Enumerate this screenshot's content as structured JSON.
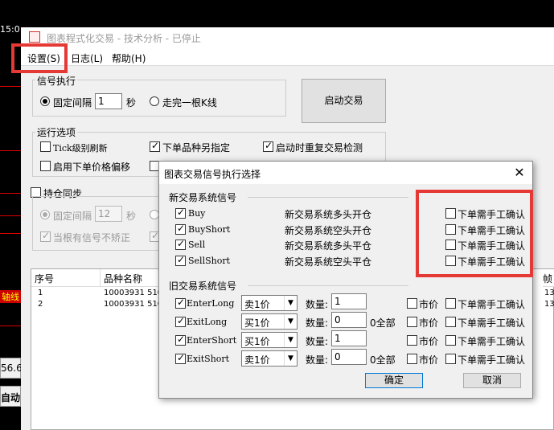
{
  "background": {
    "time_label": "15:0",
    "axis_label": "轴线",
    "price_label": "56.6",
    "auto_label": "自动"
  },
  "window": {
    "title": "图表程式化交易 - 技术分析 - 已停止",
    "menu": {
      "settings": "设置(S)",
      "log": "日志(L)",
      "help": "帮助(H)"
    }
  },
  "signal_exec": {
    "title": "信号执行",
    "fixed_interval_label": "固定间隔",
    "fixed_interval_value": "1",
    "seconds_unit": "秒",
    "finish_bar_label": "走完一根K线",
    "start_button": "启动交易"
  },
  "run_options": {
    "title": "运行选项",
    "tick_refresh": "Tick级别刷新",
    "specify_product": "下单品种另指定",
    "repeat_check": "启动时重复交易检测",
    "price_offset": "启用下单价格偏移"
  },
  "position_sync": {
    "title": "持仓同步",
    "fixed_interval_label": "固定间隔",
    "fixed_interval_value": "12",
    "seconds_unit": "秒",
    "no_correct": "当根有信号不矫正"
  },
  "table": {
    "headers": [
      "序号",
      "品种名称",
      "帧"
    ],
    "rows": [
      {
        "index": "1",
        "product": "10003931  510",
        "right": "13"
      },
      {
        "index": "2",
        "product": "10003931  510",
        "right": "13"
      }
    ]
  },
  "dialog": {
    "title": "图表交易信号执行选择",
    "close": "✕",
    "new_section": "新交易系统信号",
    "new_signals": [
      {
        "name": "Buy",
        "desc": "新交易系统多头开仓",
        "manual": "下单需手工确认"
      },
      {
        "name": "BuyShort",
        "desc": "新交易系统空头开仓",
        "manual": "下单需手工确认"
      },
      {
        "name": "Sell",
        "desc": "新交易系统多头平仓",
        "manual": "下单需手工确认"
      },
      {
        "name": "SellShort",
        "desc": "新交易系统空头平仓",
        "manual": "下单需手工确认"
      }
    ],
    "old_section": "旧交易系统信号",
    "qty_label": "数量:",
    "all_label": "0全部",
    "market_label": "市价",
    "old_signals": [
      {
        "name": "EnterLong",
        "price": "卖1价",
        "qty": "1",
        "all": "",
        "manual": "下单需手工确认"
      },
      {
        "name": "ExitLong",
        "price": "买1价",
        "qty": "0",
        "all": "0全部",
        "manual": "下单需手工确认"
      },
      {
        "name": "EnterShort",
        "price": "买1价",
        "qty": "1",
        "all": "",
        "manual": "下单需手工确认"
      },
      {
        "name": "ExitShort",
        "price": "卖1价",
        "qty": "0",
        "all": "0全部",
        "manual": "下单需手工确认"
      }
    ],
    "ok_button": "确定",
    "cancel_button": "取消"
  },
  "colors": {
    "highlight": "#e53935",
    "bg_line": "#dd0000"
  }
}
